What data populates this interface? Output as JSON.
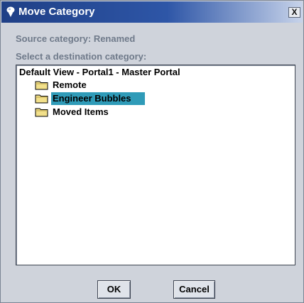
{
  "window": {
    "title": "Move Category",
    "close_glyph": "X",
    "icon": "app-icon"
  },
  "labels": {
    "source": "Source category: Renamed",
    "destination": "Select a destination category:"
  },
  "tree": {
    "root": "Default View - Portal1 - Master Portal",
    "items": [
      {
        "label": "Remote",
        "icon": "folder-icon",
        "selected": false
      },
      {
        "label": "Engineer Bubbles",
        "icon": "folder-icon",
        "selected": true
      },
      {
        "label": "Moved Items",
        "icon": "folder-icon",
        "selected": false
      }
    ]
  },
  "buttons": {
    "ok": "OK",
    "cancel": "Cancel"
  },
  "colors": {
    "selection": "#2f9bb8",
    "dialog_bg": "#cfd3db",
    "titlebar": "#1f3f86",
    "folder": "#f2e08a"
  }
}
